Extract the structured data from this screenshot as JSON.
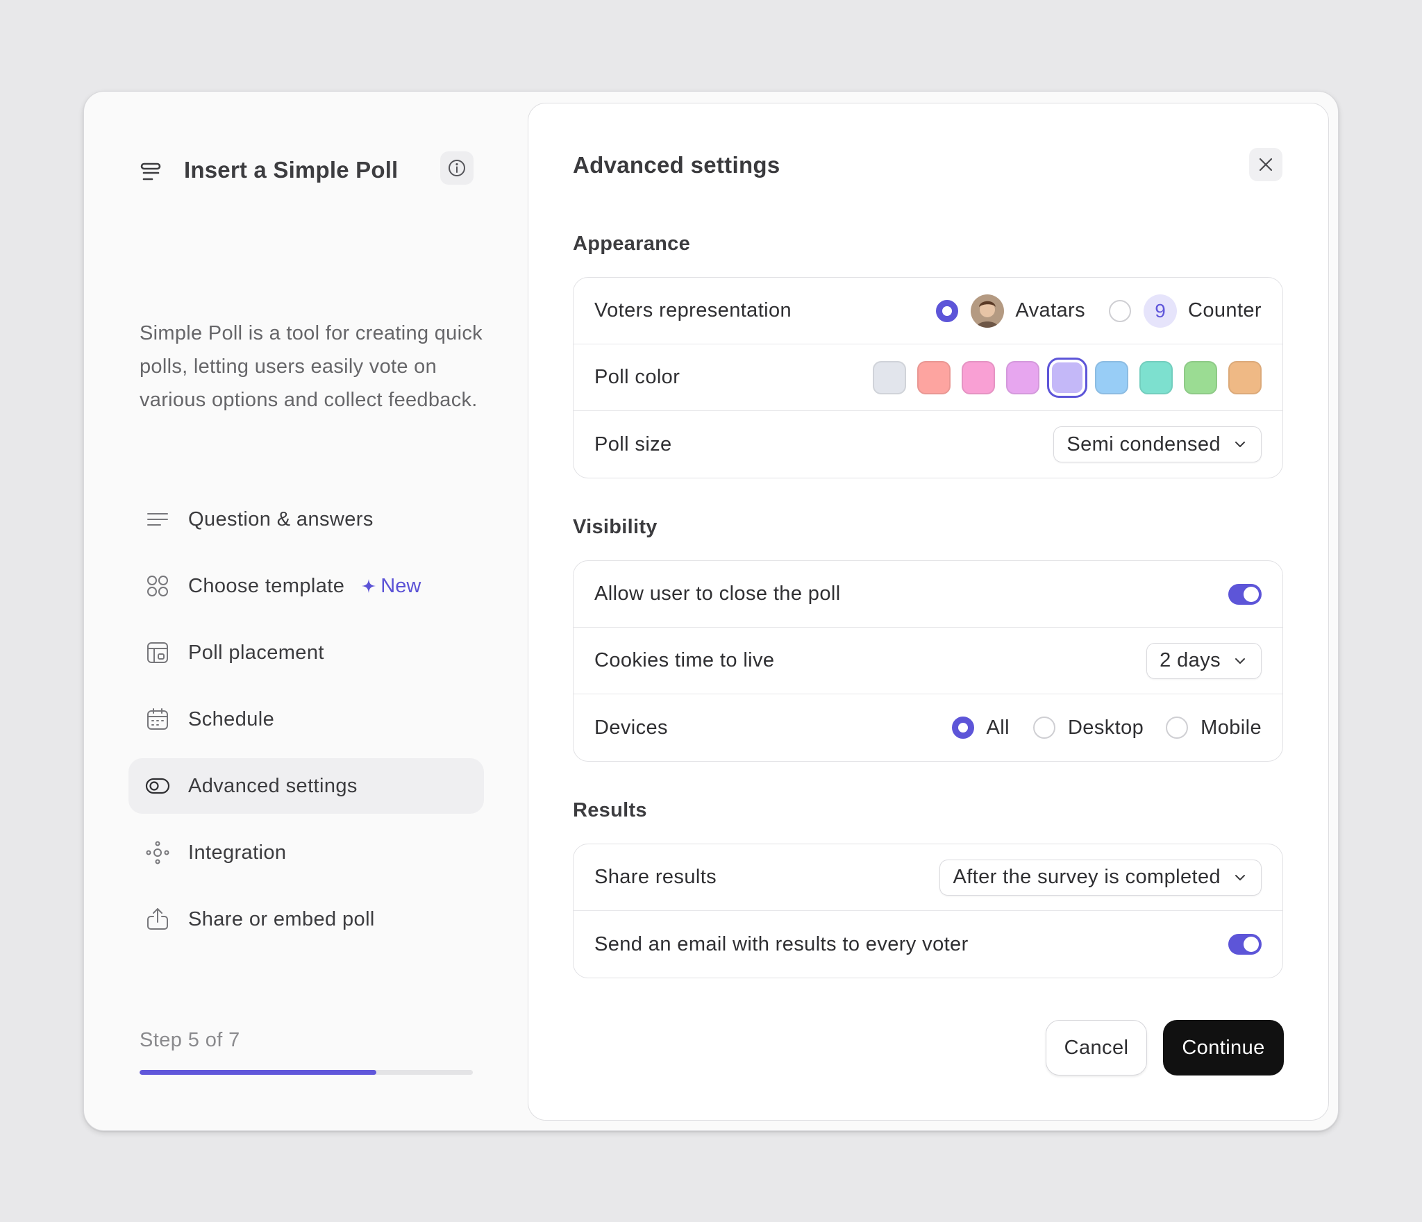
{
  "sidebar": {
    "title": "Insert a Simple Poll",
    "description": "Simple Poll is a tool for creating quick polls, letting users easily vote on various options and collect feedback.",
    "items": [
      {
        "label": "Question & answers",
        "icon": "text-lines-icon"
      },
      {
        "label": "Choose template",
        "icon": "grid-circles-icon",
        "badge": "New"
      },
      {
        "label": "Poll placement",
        "icon": "layout-icon"
      },
      {
        "label": "Schedule",
        "icon": "calendar-icon"
      },
      {
        "label": "Advanced settings",
        "icon": "toggle-icon",
        "active": true
      },
      {
        "label": "Integration",
        "icon": "nodes-icon"
      },
      {
        "label": "Share or embed poll",
        "icon": "share-icon"
      }
    ],
    "step_text": "Step 5 of 7",
    "progress": 0.71
  },
  "panel": {
    "title": "Advanced settings",
    "appearance": {
      "title": "Appearance",
      "voters_label": "Voters representation",
      "avatars_label": "Avatars",
      "counter_label": "Counter",
      "counter_value": "9",
      "color_label": "Poll color",
      "colors": [
        "#e2e5ec",
        "#fda4a0",
        "#f9a0d4",
        "#e7a6ef",
        "#c4b8f8",
        "#98cdf6",
        "#7de0cf",
        "#9bdc93",
        "#efb985"
      ],
      "selected_color_index": 4,
      "size_label": "Poll size",
      "size_value": "Semi condensed"
    },
    "visibility": {
      "title": "Visibility",
      "close_label": "Allow user to close the poll",
      "close_enabled": true,
      "cookies_label": "Cookies time to live",
      "cookies_value": "2 days",
      "devices_label": "Devices",
      "device_options": [
        "All",
        "Desktop",
        "Mobile"
      ],
      "device_selected": "All"
    },
    "results": {
      "title": "Results",
      "share_label": "Share results",
      "share_value": "After the survey is completed",
      "email_label": "Send an email with results to every voter",
      "email_enabled": true
    },
    "cancel_label": "Cancel",
    "continue_label": "Continue"
  },
  "colors": {
    "accent": "#5d55d8",
    "primary_button": "#111111"
  }
}
